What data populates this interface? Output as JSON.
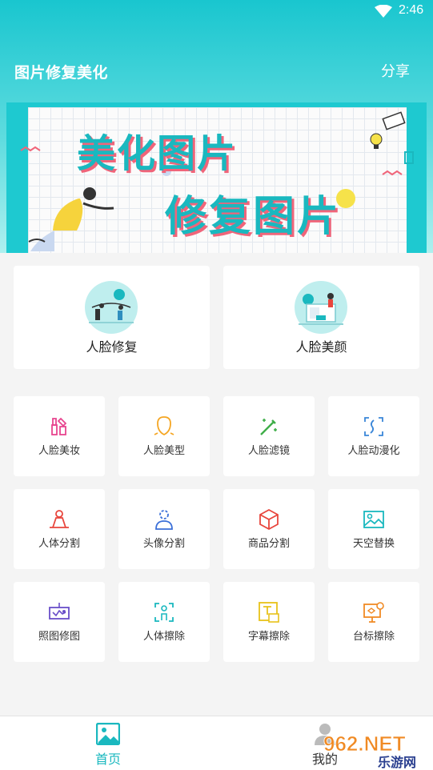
{
  "status_bar": {
    "time": "2:46"
  },
  "header": {
    "title": "图片修复美化",
    "share_label": "分享"
  },
  "banner": {
    "line1": "美化图片",
    "line2": "修复图片"
  },
  "featured": [
    {
      "label": "人脸修复",
      "icon": "face-restore-icon"
    },
    {
      "label": "人脸美颜",
      "icon": "face-beauty-icon"
    }
  ],
  "tools": [
    {
      "label": "人脸美妆",
      "icon": "makeup-icon",
      "color": "#e8458f"
    },
    {
      "label": "人脸美型",
      "icon": "face-shape-icon",
      "color": "#f5a623"
    },
    {
      "label": "人脸滤镜",
      "icon": "magic-wand-icon",
      "color": "#3fae49"
    },
    {
      "label": "人脸动漫化",
      "icon": "anime-face-icon",
      "color": "#3a86d8"
    },
    {
      "label": "人体分割",
      "icon": "body-segment-icon",
      "color": "#e8453c"
    },
    {
      "label": "头像分割",
      "icon": "avatar-segment-icon",
      "color": "#3a6fd8"
    },
    {
      "label": "商品分割",
      "icon": "product-box-icon",
      "color": "#e8453c"
    },
    {
      "label": "天空替换",
      "icon": "sky-image-icon",
      "color": "#1ab8bf"
    },
    {
      "label": "照图修图",
      "icon": "photo-edit-icon",
      "color": "#6a4fc9"
    },
    {
      "label": "人体擦除",
      "icon": "body-erase-icon",
      "color": "#1ab8bf"
    },
    {
      "label": "字幕擦除",
      "icon": "subtitle-erase-icon",
      "color": "#e8c21a"
    },
    {
      "label": "台标擦除",
      "icon": "logo-erase-icon",
      "color": "#f08a24"
    }
  ],
  "bottom_nav": [
    {
      "label": "首页",
      "icon": "home-image-icon",
      "active": true
    },
    {
      "label": "我的",
      "icon": "user-icon",
      "active": false
    }
  ],
  "watermark": {
    "text": "962.NET",
    "sub": "乐游网"
  },
  "colors": {
    "accent": "#1ab8bf",
    "banner_shadow": "#f0657a",
    "background": "#f4f4f4"
  }
}
